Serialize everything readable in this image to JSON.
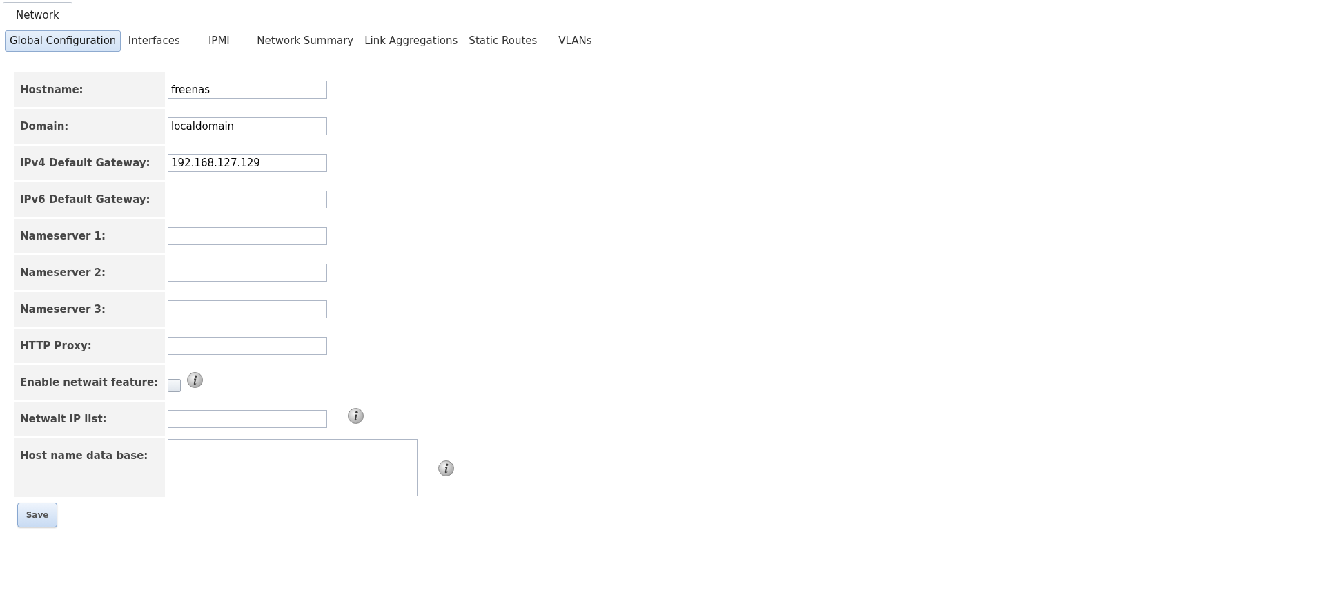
{
  "top_tabs": [
    {
      "label": "Network",
      "selected": true
    }
  ],
  "subtabs": [
    {
      "label": "Global Configuration",
      "selected": true
    },
    {
      "label": "Interfaces",
      "selected": false
    },
    {
      "label": "IPMI",
      "selected": false
    },
    {
      "label": "Network Summary",
      "selected": false
    },
    {
      "label": "Link Aggregations",
      "selected": false
    },
    {
      "label": "Static Routes",
      "selected": false
    },
    {
      "label": "VLANs",
      "selected": false
    }
  ],
  "form": {
    "fields": [
      {
        "label": "Hostname:",
        "kind": "text",
        "value": "freenas"
      },
      {
        "label": "Domain:",
        "kind": "text",
        "value": "localdomain"
      },
      {
        "label": "IPv4 Default Gateway:",
        "kind": "text",
        "value": "192.168.127.129"
      },
      {
        "label": "IPv6 Default Gateway:",
        "kind": "text"
      },
      {
        "label": "Nameserver 1:",
        "kind": "text"
      },
      {
        "label": "Nameserver 2:",
        "kind": "text"
      },
      {
        "label": "Nameserver 3:",
        "kind": "text"
      },
      {
        "label": "HTTP Proxy:",
        "kind": "text"
      },
      {
        "label": "Enable netwait feature:",
        "kind": "checkbox",
        "checked": false,
        "info_icon": true
      },
      {
        "label": "Netwait IP list:",
        "kind": "text",
        "info_icon": true
      },
      {
        "label": "Host name data base:",
        "kind": "textarea",
        "info_icon": true
      }
    ],
    "actions": [
      {
        "label": "Save"
      }
    ]
  }
}
